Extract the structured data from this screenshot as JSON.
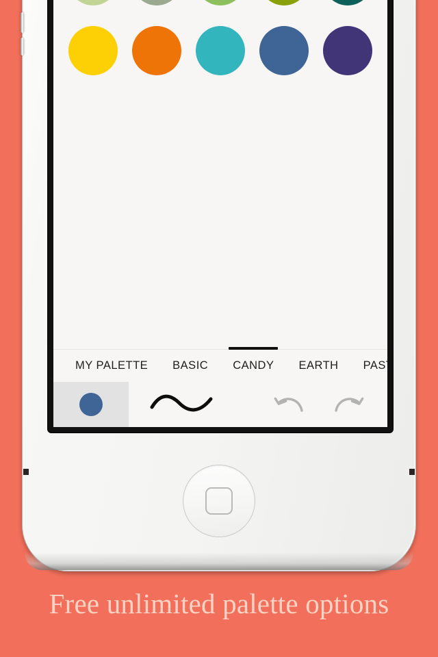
{
  "background": {
    "color": "#f2705b"
  },
  "caption": {
    "text": "Free unlimited palette options",
    "color": "#fbd2c4"
  },
  "device": {
    "name": "iphone-white",
    "body_color": "#f6f6f4",
    "screen_bg": "#f7f6f4",
    "buttons": {
      "volume_up_label": "Volume Up",
      "volume_down_label": "Volume Down",
      "home_label": "Home"
    }
  },
  "palette": {
    "active_tab_index": 2,
    "rows": [
      {
        "swatches": [
          {
            "name": "salmon-light",
            "hex": "#f79c95"
          },
          {
            "name": "rose-pink",
            "hex": "#f55a6e"
          },
          {
            "name": "crimson-red",
            "hex": "#f92f50"
          },
          {
            "name": "tomato-red",
            "hex": "#ef5641"
          },
          {
            "name": "wine-maroon",
            "hex": "#7c3446"
          }
        ]
      },
      {
        "swatches": [
          {
            "name": "dusty-rose",
            "hex": "#bd9c99"
          },
          {
            "name": "coral",
            "hex": "#fb7f6b"
          },
          {
            "name": "warm-taupe",
            "hex": "#776b60"
          },
          {
            "name": "plum-grey",
            "hex": "#5f4e55"
          },
          {
            "name": "deep-purple",
            "hex": "#4a0637"
          }
        ]
      },
      {
        "swatches": [
          {
            "name": "pale-green",
            "hex": "#c2d495"
          },
          {
            "name": "sage-green",
            "hex": "#9aa990"
          },
          {
            "name": "apple-green",
            "hex": "#8cc05c"
          },
          {
            "name": "olive-green",
            "hex": "#8aa008"
          },
          {
            "name": "deep-teal",
            "hex": "#0e615b"
          }
        ]
      },
      {
        "swatches": [
          {
            "name": "golden-yellow",
            "hex": "#fcd005"
          },
          {
            "name": "pumpkin-orange",
            "hex": "#ee7407"
          },
          {
            "name": "turquoise",
            "hex": "#33b5bd"
          },
          {
            "name": "steel-blue",
            "hex": "#3e6596"
          },
          {
            "name": "indigo-violet",
            "hex": "#413577"
          }
        ]
      }
    ],
    "tabs": [
      {
        "label": "MY PALETTE"
      },
      {
        "label": "BASIC"
      },
      {
        "label": "CANDY"
      },
      {
        "label": "EARTH"
      },
      {
        "label": "PASTEL"
      }
    ]
  },
  "toolbar": {
    "color_tool": {
      "name": "color-picker",
      "selected_color": "#3e6596",
      "active": true
    },
    "brush_tool": {
      "name": "brush-stroke",
      "color": "#0d0d0d"
    },
    "undo_tool": {
      "name": "undo",
      "color": "#b3b3b3"
    },
    "redo_tool": {
      "name": "redo",
      "color": "#b3b3b3"
    }
  }
}
